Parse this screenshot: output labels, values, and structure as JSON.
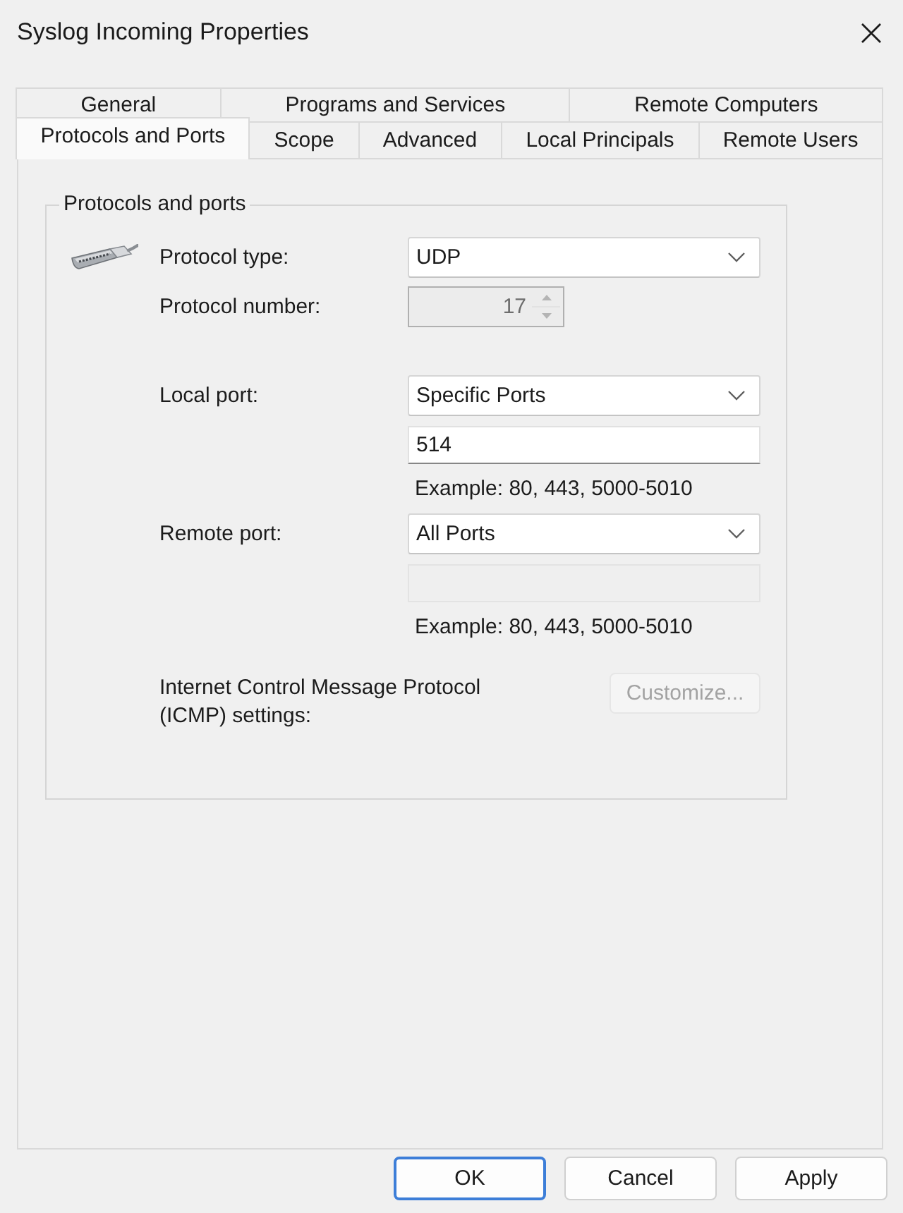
{
  "window": {
    "title": "Syslog Incoming Properties"
  },
  "tab_rows": [
    {
      "tabs": [
        {
          "label": "General",
          "selected": false
        },
        {
          "label": "Programs and Services",
          "selected": false
        },
        {
          "label": "Remote Computers",
          "selected": false
        }
      ]
    },
    {
      "tabs": [
        {
          "label": "Protocols and Ports",
          "selected": true
        },
        {
          "label": "Scope",
          "selected": false
        },
        {
          "label": "Advanced",
          "selected": false
        },
        {
          "label": "Local Principals",
          "selected": false
        },
        {
          "label": "Remote Users",
          "selected": false
        }
      ]
    }
  ],
  "group": {
    "title": "Protocols and ports",
    "protocol": {
      "type_label": "Protocol type:",
      "type": "UDP",
      "number_label": "Protocol number:",
      "number": "17",
      "number_disabled": true
    },
    "ports": [
      {
        "label": "Local port:",
        "mode": "Specific Ports",
        "value": "514",
        "disabled": false,
        "example": "Example: 80, 443, 5000-5010"
      },
      {
        "label": "Remote port:",
        "mode": "All Ports",
        "disabled": true,
        "example": "Example: 80, 443, 5000-5010"
      }
    ],
    "icmp": {
      "label": "Internet Control Message Protocol (ICMP) settings:",
      "button": "Customize...",
      "button_disabled": true
    }
  },
  "buttons": [
    {
      "label": "OK",
      "default": true
    },
    {
      "label": "Cancel",
      "default": false
    },
    {
      "label": "Apply",
      "default": false
    }
  ]
}
